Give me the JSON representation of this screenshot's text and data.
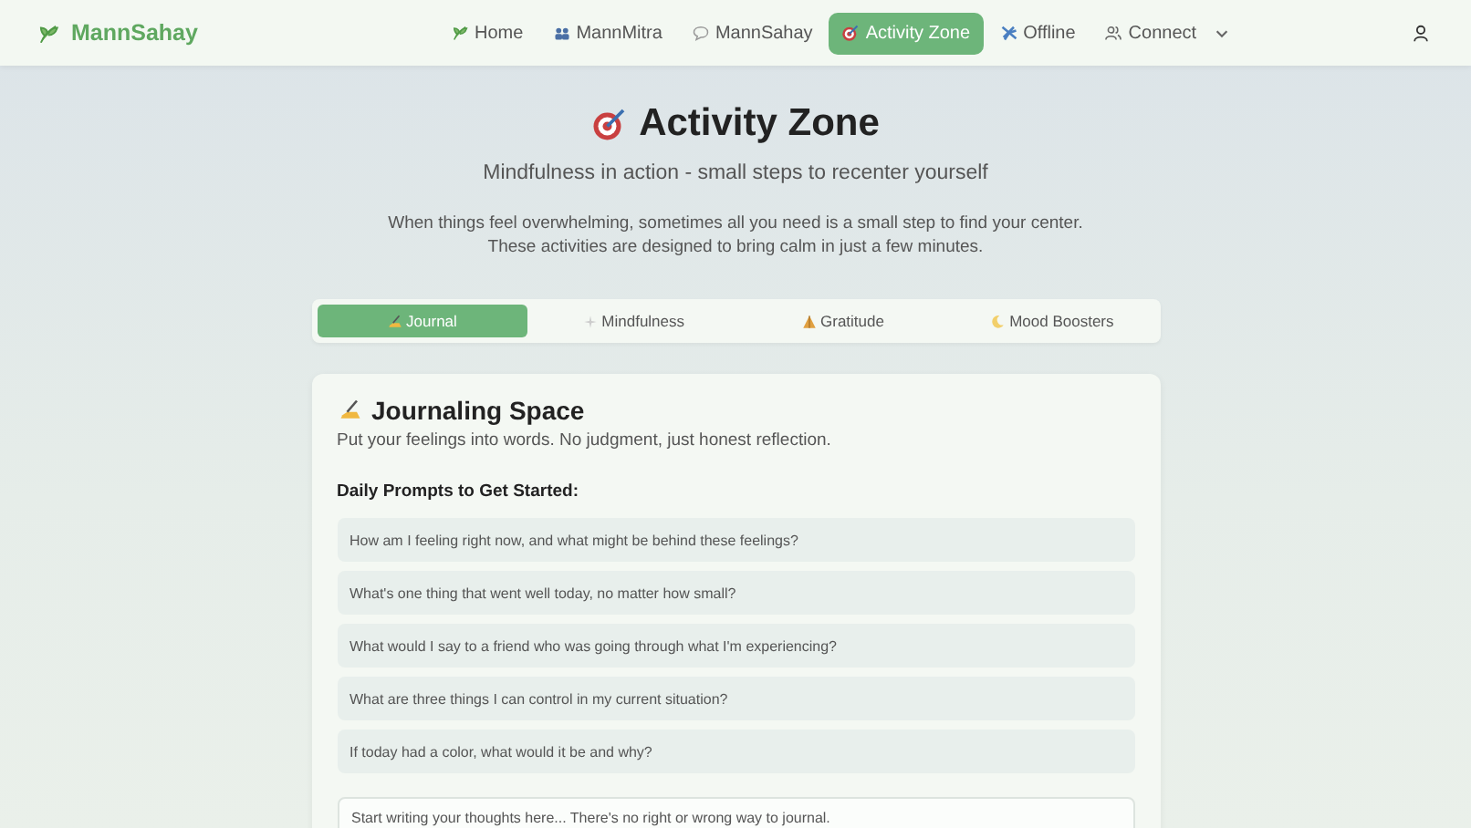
{
  "brand": "MannSahay",
  "nav": [
    {
      "label": "Home",
      "selected": false
    },
    {
      "label": "MannMitra",
      "selected": false
    },
    {
      "label": "MannSahay",
      "selected": false
    },
    {
      "label": "Activity Zone",
      "selected": true
    },
    {
      "label": "Offline",
      "selected": false
    },
    {
      "label": "Connect",
      "selected": false,
      "dropdown": true
    }
  ],
  "page": {
    "title": "Activity Zone",
    "subtitle": "Mindfulness in action - small steps to recenter yourself",
    "description": [
      "When things feel overwhelming, sometimes all you need is a small step to find your center.",
      "These activities are designed to bring calm in just a few minutes."
    ]
  },
  "tabs": [
    {
      "label": "Journal",
      "selected": true
    },
    {
      "label": "Mindfulness",
      "selected": false
    },
    {
      "label": "Gratitude",
      "selected": false
    },
    {
      "label": "Mood Boosters",
      "selected": false
    }
  ],
  "panel": {
    "title": "Journaling Space",
    "subtitle": "Put your feelings into words. No judgment, just honest reflection.",
    "prompts_heading": "Daily Prompts to Get Started:",
    "prompts": [
      "How am I feeling right now, and what might be behind these feelings?",
      "What's one thing that went well today, no matter how small?",
      "What would I say to a friend who was going through what I'm experiencing?",
      "What are three things I can control in my current situation?",
      "If today had a color, what would it be and why?"
    ],
    "editor": {
      "placeholder": "Start writing your thoughts here... There's no right or wrong way to journal."
    }
  }
}
